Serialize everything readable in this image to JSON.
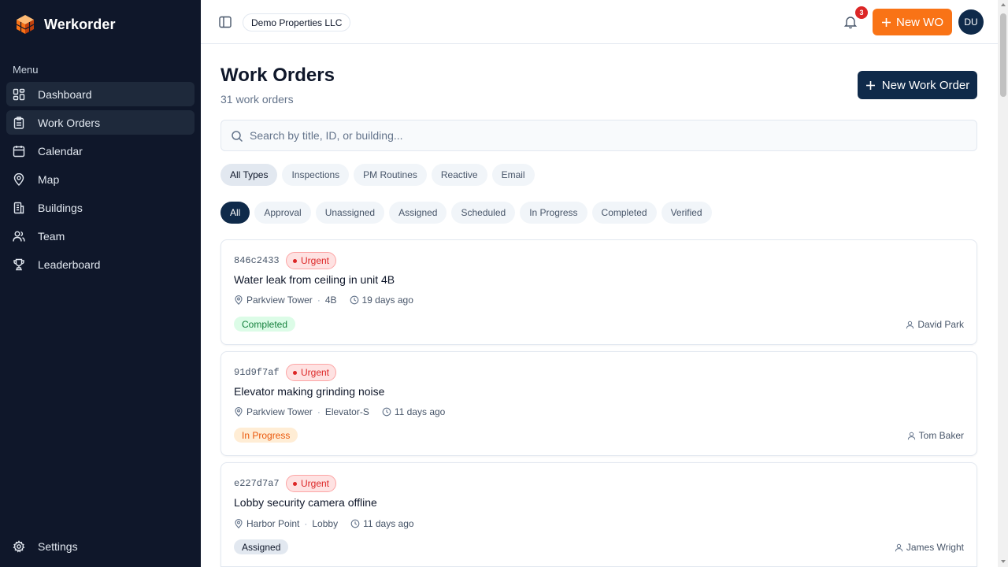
{
  "app": {
    "name": "Werkorder"
  },
  "sidebar": {
    "menu_label": "Menu",
    "items": [
      {
        "label": "Dashboard",
        "icon": "grid-icon"
      },
      {
        "label": "Work Orders",
        "icon": "clipboard-icon"
      },
      {
        "label": "Calendar",
        "icon": "calendar-icon"
      },
      {
        "label": "Map",
        "icon": "map-pin-icon"
      },
      {
        "label": "Buildings",
        "icon": "building-icon"
      },
      {
        "label": "Team",
        "icon": "users-icon"
      },
      {
        "label": "Leaderboard",
        "icon": "trophy-icon"
      }
    ],
    "settings_label": "Settings"
  },
  "header": {
    "org": "Demo Properties LLC",
    "notification_count": "3",
    "new_wo_label": "New WO",
    "avatar_initials": "DU"
  },
  "main": {
    "title": "Work Orders",
    "subtitle": "31 work orders",
    "new_button_label": "New Work Order",
    "search_placeholder": "Search by title, ID, or building...",
    "type_filters": [
      "All Types",
      "Inspections",
      "PM Routines",
      "Reactive",
      "Email"
    ],
    "status_filters": [
      "All",
      "Approval",
      "Unassigned",
      "Assigned",
      "Scheduled",
      "In Progress",
      "Completed",
      "Verified"
    ]
  },
  "work_orders": [
    {
      "id": "846c2433",
      "priority": "Urgent",
      "title": "Water leak from ceiling in unit 4B",
      "building": "Parkview Tower",
      "unit": "4B",
      "age": "19 days ago",
      "status": "Completed",
      "assignee": "David Park"
    },
    {
      "id": "91d9f7af",
      "priority": "Urgent",
      "title": "Elevator making grinding noise",
      "building": "Parkview Tower",
      "unit": "Elevator-S",
      "age": "11 days ago",
      "status": "In Progress",
      "assignee": "Tom Baker"
    },
    {
      "id": "e227d7a7",
      "priority": "Urgent",
      "title": "Lobby security camera offline",
      "building": "Harbor Point",
      "unit": "Lobby",
      "age": "11 days ago",
      "status": "Assigned",
      "assignee": "James Wright"
    }
  ],
  "colors": {
    "sidebar_bg": "#0f172a",
    "accent_orange": "#f97316",
    "primary_navy": "#0f2a4a",
    "urgent_red": "#dc2626",
    "completed_green": "#15803d"
  }
}
